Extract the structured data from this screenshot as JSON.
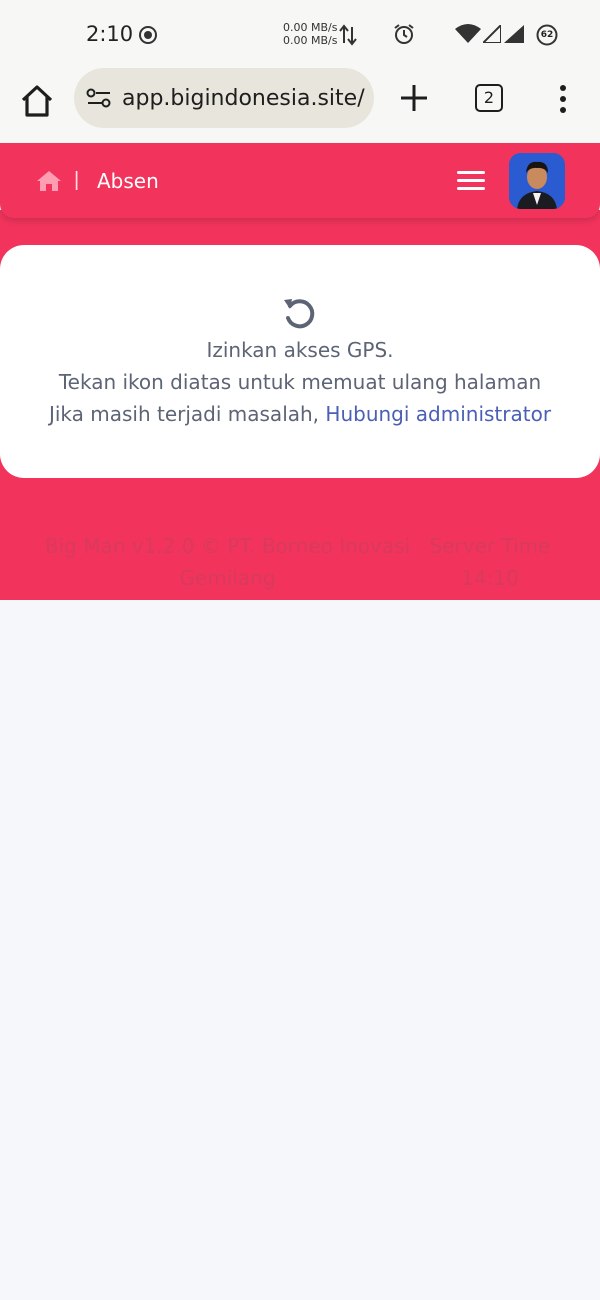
{
  "status_bar": {
    "time": "2:10",
    "net_up": "0.00 MB/s",
    "net_down": "0.00 MB/s",
    "battery": "62",
    "icons": [
      "record-icon",
      "updown-arrows-icon",
      "alarm-icon",
      "wifi-icon",
      "signal-icon",
      "signal-icon",
      "battery-icon"
    ]
  },
  "browser": {
    "url": "app.bigindonesia.site/",
    "tab_count": "2",
    "icons": [
      "home-icon",
      "site-settings-icon",
      "plus-icon",
      "tabs-icon",
      "more-vert-icon"
    ]
  },
  "header": {
    "separator": "|",
    "title": "Absen",
    "icons": [
      "home-icon",
      "hamburger-icon",
      "avatar"
    ],
    "color": "#f2345c"
  },
  "gps_card": {
    "line1": "Izinkan akses GPS.",
    "line2": "Tekan ikon diatas untuk memuat ulang halaman",
    "line3_prefix": "Jika masih terjadi masalah, ",
    "link_text": "Hubungi administrator",
    "icon": "reload-icon"
  },
  "footer": {
    "copyright": "Big Man v1.2.0 © PT. Borneo Inovasi Gemilang",
    "server_time_label": "Server Time",
    "server_time_value": "14:10"
  },
  "colors": {
    "accent": "#f2345c",
    "link": "#4a5fb5",
    "text": "#5d6476",
    "background": "#f6f7fb"
  }
}
